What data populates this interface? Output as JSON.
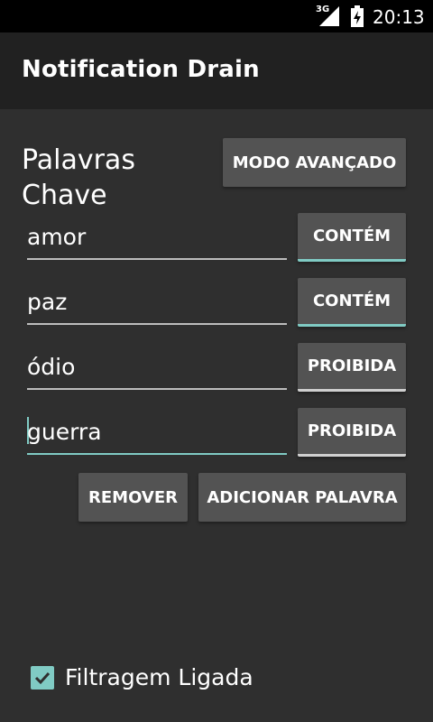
{
  "status": {
    "network": "3G",
    "time": "20:13",
    "icons": [
      "signal-icon",
      "battery-icon"
    ]
  },
  "app": {
    "title": "Notification Drain"
  },
  "keywords": {
    "title": "Palavras Chave",
    "advanced_button": "MODO AVANÇADO",
    "rows": [
      {
        "word": "amor",
        "mode": "CONTÉM",
        "mode_active": true
      },
      {
        "word": "paz",
        "mode": "CONTÉM",
        "mode_active": true
      },
      {
        "word": "ódio",
        "mode": "PROIBIDA",
        "mode_active": false
      },
      {
        "word": "guerra",
        "mode": "PROIBIDA",
        "mode_active": false
      }
    ],
    "remove_button": "REMOVER",
    "add_button": "ADICIONAR PALAVRA"
  },
  "filter": {
    "label": "Filtragem Ligada",
    "checked": true
  },
  "colors": {
    "accent": "#80cbc4",
    "background": "#2f2f2f",
    "app_bar": "#212121",
    "button": "#535353"
  }
}
